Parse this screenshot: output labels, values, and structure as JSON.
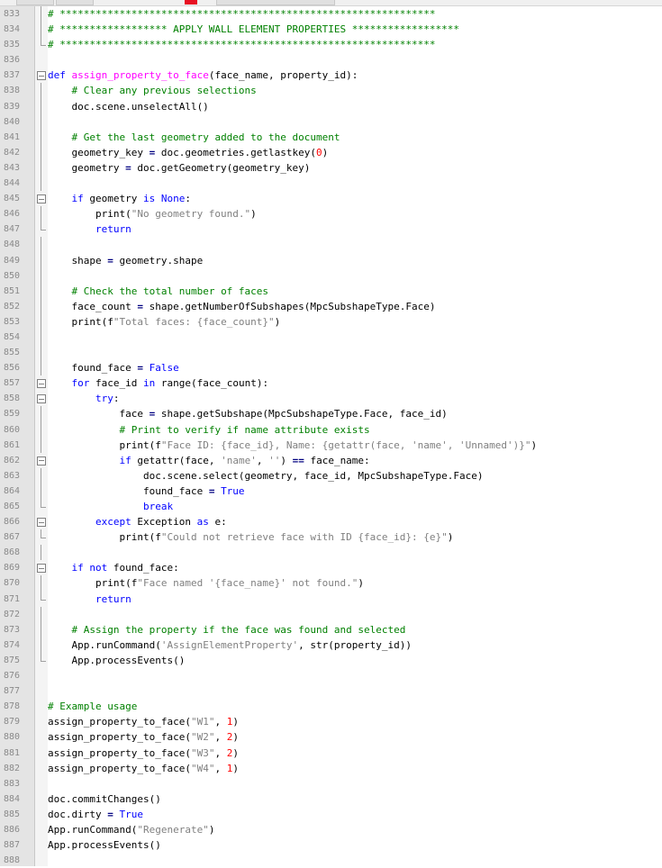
{
  "editor": {
    "lines": [
      {
        "n": "833",
        "fold": "line",
        "parts": [
          {
            "t": "# ***************************************************************",
            "c": "cmt"
          }
        ]
      },
      {
        "n": "834",
        "fold": "line",
        "parts": [
          {
            "t": "# ****************** APPLY WALL ELEMENT PROPERTIES ******************",
            "c": "cmt"
          }
        ]
      },
      {
        "n": "835",
        "fold": "end",
        "parts": [
          {
            "t": "# ***************************************************************",
            "c": "cmt"
          }
        ]
      },
      {
        "n": "836",
        "fold": "",
        "parts": []
      },
      {
        "n": "837",
        "fold": "open",
        "parts": [
          {
            "t": "def",
            "c": "kw"
          },
          {
            "t": " "
          },
          {
            "t": "assign_property_to_face",
            "c": "fn"
          },
          {
            "t": "(face_name, property_id):"
          }
        ]
      },
      {
        "n": "838",
        "fold": "line",
        "parts": [
          {
            "t": "    "
          },
          {
            "t": "# Clear any previous selections",
            "c": "cmt"
          }
        ]
      },
      {
        "n": "839",
        "fold": "line",
        "parts": [
          {
            "t": "    doc.scene.unselectAll()"
          }
        ]
      },
      {
        "n": "840",
        "fold": "line",
        "parts": []
      },
      {
        "n": "841",
        "fold": "line",
        "parts": [
          {
            "t": "    "
          },
          {
            "t": "# Get the last geometry added to the document",
            "c": "cmt"
          }
        ]
      },
      {
        "n": "842",
        "fold": "line",
        "parts": [
          {
            "t": "    geometry_key "
          },
          {
            "t": "=",
            "c": "op"
          },
          {
            "t": " doc.geometries.getlastkey("
          },
          {
            "t": "0",
            "c": "num"
          },
          {
            "t": ")"
          }
        ]
      },
      {
        "n": "843",
        "fold": "line",
        "parts": [
          {
            "t": "    geometry "
          },
          {
            "t": "=",
            "c": "op"
          },
          {
            "t": " doc.getGeometry(geometry_key)"
          }
        ]
      },
      {
        "n": "844",
        "fold": "line",
        "parts": []
      },
      {
        "n": "845",
        "fold": "open",
        "parts": [
          {
            "t": "    "
          },
          {
            "t": "if",
            "c": "kw"
          },
          {
            "t": " geometry "
          },
          {
            "t": "is",
            "c": "kw"
          },
          {
            "t": " "
          },
          {
            "t": "None",
            "c": "kw"
          },
          {
            "t": ":"
          }
        ]
      },
      {
        "n": "846",
        "fold": "line",
        "parts": [
          {
            "t": "        print("
          },
          {
            "t": "\"No geometry found.\"",
            "c": "str"
          },
          {
            "t": ")"
          }
        ]
      },
      {
        "n": "847",
        "fold": "end",
        "parts": [
          {
            "t": "        "
          },
          {
            "t": "return",
            "c": "kw"
          }
        ]
      },
      {
        "n": "848",
        "fold": "line",
        "parts": []
      },
      {
        "n": "849",
        "fold": "line",
        "parts": [
          {
            "t": "    shape "
          },
          {
            "t": "=",
            "c": "op"
          },
          {
            "t": " geometry.shape"
          }
        ]
      },
      {
        "n": "850",
        "fold": "line",
        "parts": []
      },
      {
        "n": "851",
        "fold": "line",
        "parts": [
          {
            "t": "    "
          },
          {
            "t": "# Check the total number of faces",
            "c": "cmt"
          }
        ]
      },
      {
        "n": "852",
        "fold": "line",
        "parts": [
          {
            "t": "    face_count "
          },
          {
            "t": "=",
            "c": "op"
          },
          {
            "t": " shape.getNumberOfSubshapes(MpcSubshapeType.Face)"
          }
        ]
      },
      {
        "n": "853",
        "fold": "line",
        "parts": [
          {
            "t": "    print(f"
          },
          {
            "t": "\"Total faces: {face_count}\"",
            "c": "str"
          },
          {
            "t": ")"
          }
        ]
      },
      {
        "n": "854",
        "fold": "line",
        "parts": []
      },
      {
        "n": "855",
        "fold": "line",
        "parts": []
      },
      {
        "n": "856",
        "fold": "line",
        "parts": [
          {
            "t": "    found_face "
          },
          {
            "t": "=",
            "c": "op"
          },
          {
            "t": " "
          },
          {
            "t": "False",
            "c": "kw"
          }
        ]
      },
      {
        "n": "857",
        "fold": "open",
        "parts": [
          {
            "t": "    "
          },
          {
            "t": "for",
            "c": "kw"
          },
          {
            "t": " face_id "
          },
          {
            "t": "in",
            "c": "kw"
          },
          {
            "t": " range(face_count):"
          }
        ]
      },
      {
        "n": "858",
        "fold": "open",
        "parts": [
          {
            "t": "        "
          },
          {
            "t": "try",
            "c": "kw"
          },
          {
            "t": ":"
          }
        ]
      },
      {
        "n": "859",
        "fold": "line",
        "parts": [
          {
            "t": "            face "
          },
          {
            "t": "=",
            "c": "op"
          },
          {
            "t": " shape.getSubshape(MpcSubshapeType.Face, face_id)"
          }
        ]
      },
      {
        "n": "860",
        "fold": "line",
        "parts": [
          {
            "t": "            "
          },
          {
            "t": "# Print to verify if name attribute exists",
            "c": "cmt"
          }
        ]
      },
      {
        "n": "861",
        "fold": "line",
        "parts": [
          {
            "t": "            print(f"
          },
          {
            "t": "\"Face ID: {face_id}, Name: {getattr(face, 'name', 'Unnamed')}\"",
            "c": "str"
          },
          {
            "t": ")"
          }
        ]
      },
      {
        "n": "862",
        "fold": "open",
        "parts": [
          {
            "t": "            "
          },
          {
            "t": "if",
            "c": "kw"
          },
          {
            "t": " getattr(face, "
          },
          {
            "t": "'name'",
            "c": "str"
          },
          {
            "t": ", "
          },
          {
            "t": "''",
            "c": "str"
          },
          {
            "t": ") "
          },
          {
            "t": "==",
            "c": "op"
          },
          {
            "t": " face_name:"
          }
        ]
      },
      {
        "n": "863",
        "fold": "line",
        "parts": [
          {
            "t": "                doc.scene.select(geometry, face_id, MpcSubshapeType.Face)"
          }
        ]
      },
      {
        "n": "864",
        "fold": "line",
        "parts": [
          {
            "t": "                found_face "
          },
          {
            "t": "=",
            "c": "op"
          },
          {
            "t": " "
          },
          {
            "t": "True",
            "c": "kw"
          }
        ]
      },
      {
        "n": "865",
        "fold": "end",
        "parts": [
          {
            "t": "                "
          },
          {
            "t": "break",
            "c": "kw"
          }
        ]
      },
      {
        "n": "866",
        "fold": "open",
        "parts": [
          {
            "t": "        "
          },
          {
            "t": "except",
            "c": "kw"
          },
          {
            "t": " Exception "
          },
          {
            "t": "as",
            "c": "kw"
          },
          {
            "t": " e:"
          }
        ]
      },
      {
        "n": "867",
        "fold": "end",
        "parts": [
          {
            "t": "            print(f"
          },
          {
            "t": "\"Could not retrieve face with ID {face_id}: {e}\"",
            "c": "str"
          },
          {
            "t": ")"
          }
        ]
      },
      {
        "n": "868",
        "fold": "line",
        "parts": []
      },
      {
        "n": "869",
        "fold": "open",
        "parts": [
          {
            "t": "    "
          },
          {
            "t": "if",
            "c": "kw"
          },
          {
            "t": " "
          },
          {
            "t": "not",
            "c": "kw"
          },
          {
            "t": " found_face:"
          }
        ]
      },
      {
        "n": "870",
        "fold": "line",
        "parts": [
          {
            "t": "        print(f"
          },
          {
            "t": "\"Face named '{face_name}' not found.\"",
            "c": "str"
          },
          {
            "t": ")"
          }
        ]
      },
      {
        "n": "871",
        "fold": "end",
        "parts": [
          {
            "t": "        "
          },
          {
            "t": "return",
            "c": "kw"
          }
        ]
      },
      {
        "n": "872",
        "fold": "line",
        "parts": []
      },
      {
        "n": "873",
        "fold": "line",
        "parts": [
          {
            "t": "    "
          },
          {
            "t": "# Assign the property if the face was found and selected",
            "c": "cmt"
          }
        ]
      },
      {
        "n": "874",
        "fold": "line",
        "parts": [
          {
            "t": "    App.runCommand("
          },
          {
            "t": "'AssignElementProperty'",
            "c": "str"
          },
          {
            "t": ", str(property_id))"
          }
        ]
      },
      {
        "n": "875",
        "fold": "end",
        "parts": [
          {
            "t": "    App.processEvents()"
          }
        ]
      },
      {
        "n": "876",
        "fold": "",
        "parts": []
      },
      {
        "n": "877",
        "fold": "",
        "parts": []
      },
      {
        "n": "878",
        "fold": "",
        "parts": [
          {
            "t": "# Example usage",
            "c": "cmt"
          }
        ]
      },
      {
        "n": "879",
        "fold": "",
        "parts": [
          {
            "t": "assign_property_to_face("
          },
          {
            "t": "\"W1\"",
            "c": "str"
          },
          {
            "t": ", "
          },
          {
            "t": "1",
            "c": "num"
          },
          {
            "t": ")"
          }
        ]
      },
      {
        "n": "880",
        "fold": "",
        "parts": [
          {
            "t": "assign_property_to_face("
          },
          {
            "t": "\"W2\"",
            "c": "str"
          },
          {
            "t": ", "
          },
          {
            "t": "2",
            "c": "num"
          },
          {
            "t": ")"
          }
        ]
      },
      {
        "n": "881",
        "fold": "",
        "parts": [
          {
            "t": "assign_property_to_face("
          },
          {
            "t": "\"W3\"",
            "c": "str"
          },
          {
            "t": ", "
          },
          {
            "t": "2",
            "c": "num"
          },
          {
            "t": ")"
          }
        ]
      },
      {
        "n": "882",
        "fold": "",
        "parts": [
          {
            "t": "assign_property_to_face("
          },
          {
            "t": "\"W4\"",
            "c": "str"
          },
          {
            "t": ", "
          },
          {
            "t": "1",
            "c": "num"
          },
          {
            "t": ")"
          }
        ]
      },
      {
        "n": "883",
        "fold": "",
        "parts": []
      },
      {
        "n": "884",
        "fold": "",
        "parts": [
          {
            "t": "doc.commitChanges()"
          }
        ]
      },
      {
        "n": "885",
        "fold": "",
        "parts": [
          {
            "t": "doc.dirty "
          },
          {
            "t": "=",
            "c": "op"
          },
          {
            "t": " "
          },
          {
            "t": "True",
            "c": "kw"
          }
        ]
      },
      {
        "n": "886",
        "fold": "",
        "parts": [
          {
            "t": "App.runCommand("
          },
          {
            "t": "\"Regenerate\"",
            "c": "str"
          },
          {
            "t": ")"
          }
        ]
      },
      {
        "n": "887",
        "fold": "",
        "parts": [
          {
            "t": "App.processEvents()"
          }
        ]
      },
      {
        "n": "888",
        "fold": "",
        "parts": []
      }
    ]
  }
}
